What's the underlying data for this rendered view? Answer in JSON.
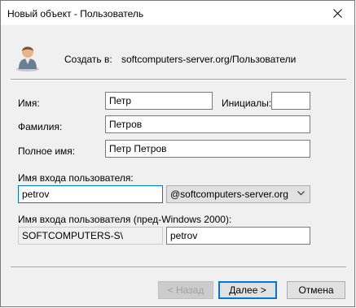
{
  "window": {
    "title": "Новый объект - Пользователь"
  },
  "header": {
    "create_in_label": "Создать в:",
    "create_in_path": "softcomputers-server.org/Пользователи"
  },
  "form": {
    "first_name_label": "Имя:",
    "first_name_value": "Петр",
    "initials_label": "Инициалы:",
    "initials_value": "",
    "last_name_label": "Фамилия:",
    "last_name_value": "Петров",
    "full_name_label": "Полное имя:",
    "full_name_value": "Петр Петров",
    "logon_name_label": "Имя входа пользователя:",
    "logon_name_value": "petrov",
    "domain_suffix_value": "@softcomputers-server.org",
    "pre2000_label": "Имя входа пользователя (пред-Windows 2000):",
    "pre2000_domain_value": "SOFTCOMPUTERS-S\\",
    "pre2000_name_value": "petrov"
  },
  "buttons": {
    "back_label": "< Назад",
    "next_label": "Далее >",
    "cancel_label": "Отмена"
  }
}
